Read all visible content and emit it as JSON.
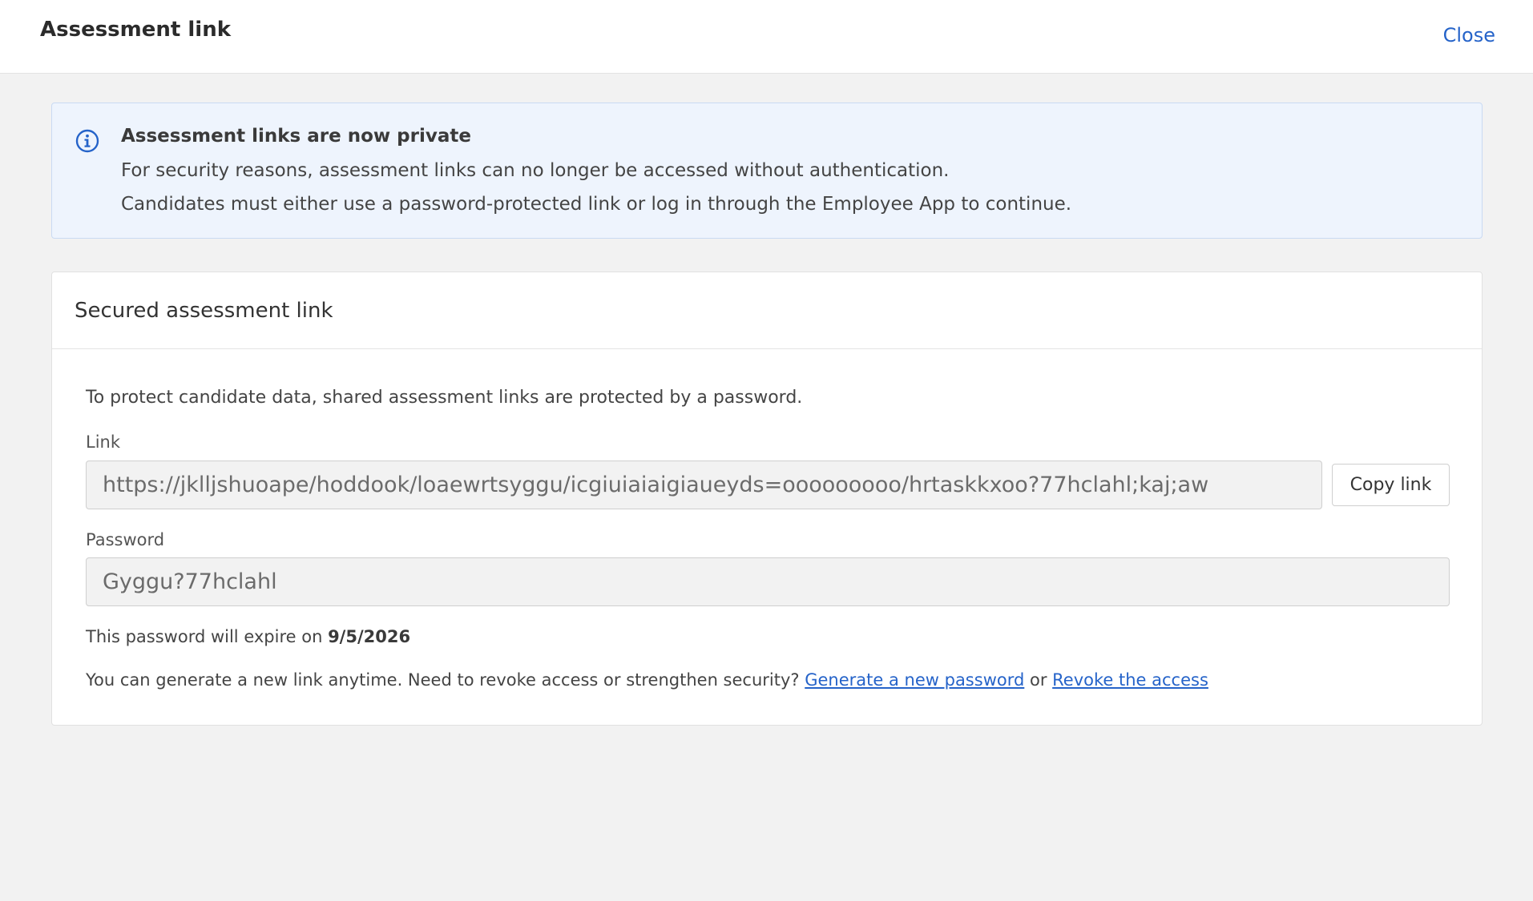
{
  "header": {
    "title": "Assessment link",
    "close_label": "Close"
  },
  "info_banner": {
    "icon": "info-icon",
    "title": "Assessment links are now private",
    "line1": "For security reasons, assessment links can no longer be accessed without authentication.",
    "line2": "Candidates must either use a password-protected link or log in through the Employee App to continue."
  },
  "secured_card": {
    "title": "Secured assessment link",
    "description": "To protect candidate data, shared assessment links are protected by a password.",
    "link_label": "Link",
    "link_value": "https://jklljshuoape/hoddook/loaewrtsyggu/icgiuiaiaigiaueyds=ooooooooo/hrtaskkxoo?77hclahl;kaj;aw",
    "copy_button_label": "Copy link",
    "password_label": "Password",
    "password_value": "Gyggu?77hclahl",
    "expire_prefix": "This password will expire on ",
    "expire_date": "9/5/2026",
    "generate_prefix": "You can generate a new link anytime. Need to revoke access or strengthen security? ",
    "generate_link": "Generate a new password",
    "or_text": " or ",
    "revoke_link": "Revoke the access"
  },
  "colors": {
    "accent": "#2563c9",
    "banner_bg": "#eef4fd",
    "page_bg": "#f2f2f2"
  }
}
